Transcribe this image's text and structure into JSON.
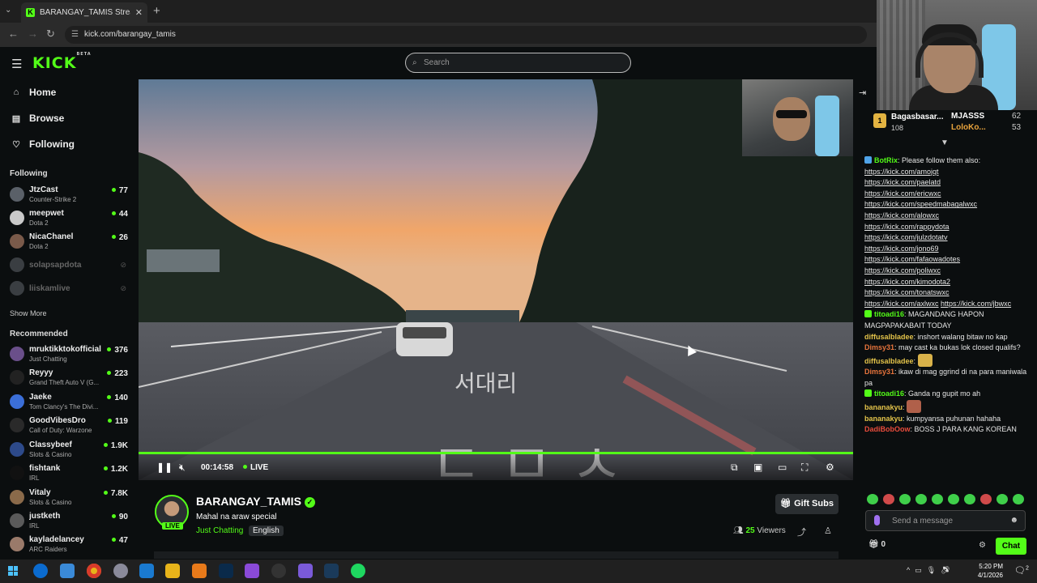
{
  "browser": {
    "tab_title": "BARANGAY_TAMIS Stream - W",
    "url": "kick.com/barangay_tamis"
  },
  "header": {
    "logo": "KICK",
    "logo_badge": "BETA",
    "search_placeholder": "Search"
  },
  "sidebar": {
    "nav": [
      {
        "label": "Home",
        "icon": "home-icon"
      },
      {
        "label": "Browse",
        "icon": "browse-icon"
      },
      {
        "label": "Following",
        "icon": "heart-icon"
      }
    ],
    "following_title": "Following",
    "following": [
      {
        "name": "JtzCast",
        "game": "Counter-Strike 2",
        "viewers": "77"
      },
      {
        "name": "meepwet",
        "game": "Dota 2",
        "viewers": "44"
      },
      {
        "name": "NicaChanel",
        "game": "Dota 2",
        "viewers": "26"
      },
      {
        "name": "solapsapdota",
        "offline": true
      },
      {
        "name": "liiskamlive",
        "offline": true
      }
    ],
    "show_more": "Show More",
    "recommended_title": "Recommended",
    "recommended": [
      {
        "name": "mruktikktokofficial",
        "game": "Just Chatting",
        "viewers": "376"
      },
      {
        "name": "Reyyy",
        "game": "Grand Theft Auto V (G...",
        "viewers": "223"
      },
      {
        "name": "Jaeke",
        "game": "Tom Clancy's The Divi...",
        "viewers": "140"
      },
      {
        "name": "GoodVibesDro",
        "game": "Call of Duty: Warzone",
        "viewers": "119"
      },
      {
        "name": "Classybeef",
        "game": "Slots & Casino",
        "viewers": "1.9K"
      },
      {
        "name": "fishtank",
        "game": "IRL",
        "viewers": "1.2K"
      },
      {
        "name": "Vitaly",
        "game": "Slots & Casino",
        "viewers": "7.8K"
      },
      {
        "name": "justketh",
        "game": "IRL",
        "viewers": "90"
      },
      {
        "name": "kayladelancey",
        "game": "ARC Raiders",
        "viewers": "47"
      }
    ]
  },
  "player": {
    "time": "00:14:58",
    "live_label": "LIVE"
  },
  "stream": {
    "channel": "BARANGAY_TAMIS",
    "title": "Mahal na araw special",
    "category": "Just Chatting",
    "language": "English",
    "live_badge": "LIVE",
    "gift_label": "Gift Subs",
    "viewers_count": "25",
    "viewers_label": "Viewers"
  },
  "chat": {
    "leaderboard": {
      "first_rank": "1",
      "first_name": "Bagasbasar...",
      "first_value": "108",
      "second_name": "MJASSS",
      "second_value": "62",
      "third_name": "LoloKo...",
      "third_value": "53"
    },
    "messages": [
      {
        "user": "BotRix",
        "color": "#53fc18",
        "badge": "bot",
        "text": "Please follow them also:"
      },
      {
        "link": "https://kick.com/amojqt"
      },
      {
        "link": "https://kick.com/paelatd"
      },
      {
        "link": "https://kick.com/ericwxc"
      },
      {
        "link": "https://kick.com/speedmabagalwxc"
      },
      {
        "link": "https://kick.com/alowxc"
      },
      {
        "link": "https://kick.com/rappydota"
      },
      {
        "link": "https://kick.com/julzdotatv"
      },
      {
        "link": "https://kick.com/jono69"
      },
      {
        "link": "https://kick.com/fafaowadotes"
      },
      {
        "link": "https://kick.com/poliwxc"
      },
      {
        "link": "https://kick.com/kimodota2"
      },
      {
        "link": "https://kick.com/tonatswxc"
      },
      {
        "link": "https://kick.com/axlwxc",
        "link2": "https://kick.com/jbwxc"
      },
      {
        "user": "titoadi16",
        "color": "#53fc18",
        "badge": "sub",
        "text": "MAGANDANG HAPON MAGPAPAKABAIT TODAY"
      },
      {
        "user": "diffusalbladee",
        "color": "#e3c34a",
        "text": "inshort walang bitaw no kap"
      },
      {
        "user": "Dimsy31",
        "color": "#e8743c",
        "text": "may cast ka bukas lok closed qualifs?"
      },
      {
        "user": "diffusalbladee",
        "color": "#e3c34a",
        "text": "",
        "emote": "#d9b24a"
      },
      {
        "user": "Dimsy31",
        "color": "#e8743c",
        "text": "ikaw di mag ggrind di na para maniwala pa"
      },
      {
        "user": "titoadi16",
        "color": "#53fc18",
        "badge": "sub",
        "text": "Ganda ng gupit mo ah"
      },
      {
        "user": "bananakyu",
        "color": "#e3c34a",
        "text": "",
        "emote": "#b0604a"
      },
      {
        "user": "bananakyu",
        "color": "#e3c34a",
        "text": "kumpyansa puhunan hahaha"
      },
      {
        "user": "DadiBobOow",
        "color": "#e84c3c",
        "text": "BOSS J PARA KANG KOREAN"
      }
    ],
    "input_placeholder": "Send a message",
    "gift_count": "0",
    "chat_button": "Chat"
  },
  "taskbar": {
    "time": "5:20 PM",
    "date": "4/1/2026",
    "notifications": "2"
  }
}
